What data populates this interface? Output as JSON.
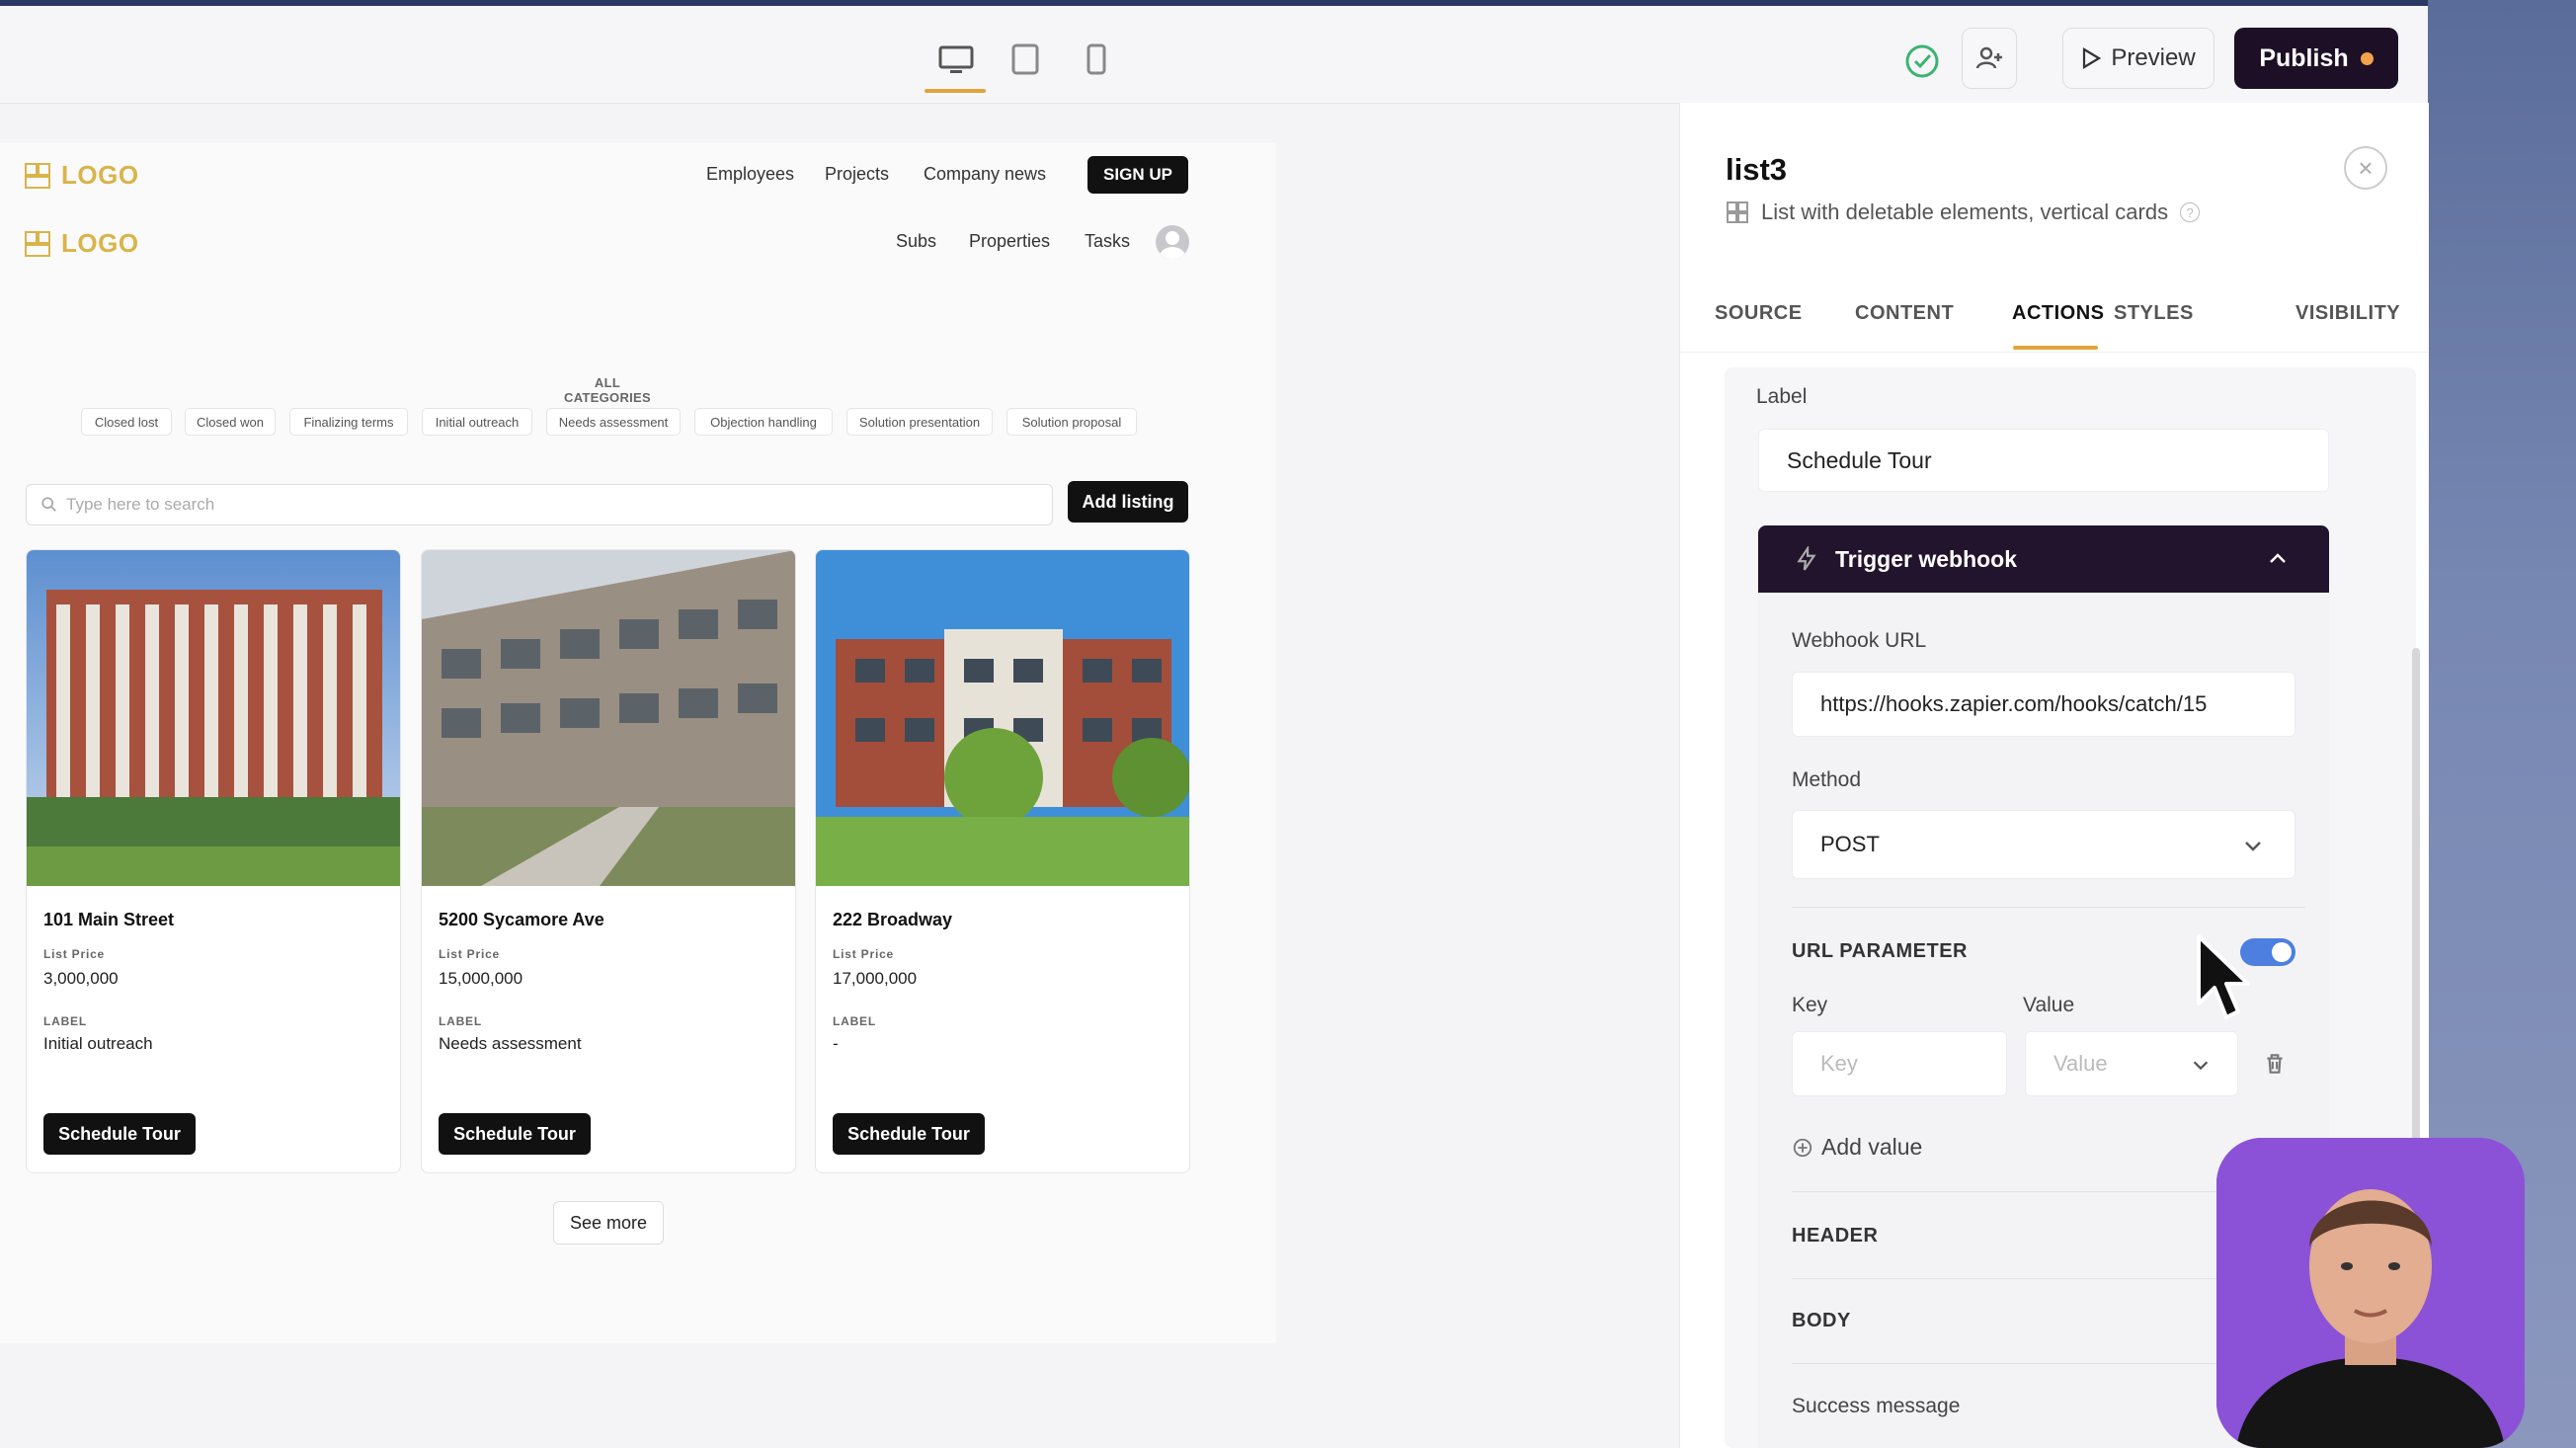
{
  "toolbar": {
    "preview_label": "Preview",
    "publish_label": "Publish",
    "colors": {
      "accent": "#e0a43a",
      "publish_bg": "#1d1026",
      "publish_dot": "#f2a24a"
    }
  },
  "site": {
    "logo_text": "LOGO",
    "nav_primary": [
      "Employees",
      "Projects",
      "Company news"
    ],
    "signup_label": "SIGN UP",
    "nav_secondary": [
      "Subs",
      "Properties",
      "Tasks"
    ],
    "categories_title": "ALL CATEGORIES",
    "categories": [
      "Closed lost",
      "Closed won",
      "Finalizing terms",
      "Initial outreach",
      "Needs assessment",
      "Objection handling",
      "Solution presentation",
      "Solution proposal"
    ],
    "search_placeholder": "Type here to search",
    "add_listing_label": "Add listing",
    "cards": [
      {
        "title": "101 Main Street",
        "price_label": "List Price",
        "price": "3,000,000",
        "label_label": "LABEL",
        "label": "Initial outreach",
        "button": "Schedule Tour"
      },
      {
        "title": "5200 Sycamore Ave",
        "price_label": "List Price",
        "price": "15,000,000",
        "label_label": "LABEL",
        "label": "Needs assessment",
        "button": "Schedule Tour"
      },
      {
        "title": "222 Broadway",
        "price_label": "List Price",
        "price": "17,000,000",
        "label_label": "LABEL",
        "label": "-",
        "button": "Schedule Tour"
      }
    ],
    "see_more_label": "See more"
  },
  "panel": {
    "title": "list3",
    "subtitle": "List with deletable elements, vertical cards",
    "tabs": [
      "SOURCE",
      "CONTENT",
      "ACTIONS",
      "STYLES",
      "VISIBILITY"
    ],
    "active_tab": "ACTIONS",
    "label_field_label": "Label",
    "label_value": "Schedule Tour",
    "webhook_title": "Trigger webhook",
    "webhook_url_label": "Webhook URL",
    "webhook_url_value": "https://hooks.zapier.com/hooks/catch/15",
    "method_label": "Method",
    "method_value": "POST",
    "url_param_label": "URL PARAMETER",
    "key_label": "Key",
    "value_label": "Value",
    "key_placeholder": "Key",
    "value_placeholder": "Value",
    "add_value_label": "Add value",
    "header_label": "HEADER",
    "body_label": "BODY",
    "success_label": "Success message"
  }
}
